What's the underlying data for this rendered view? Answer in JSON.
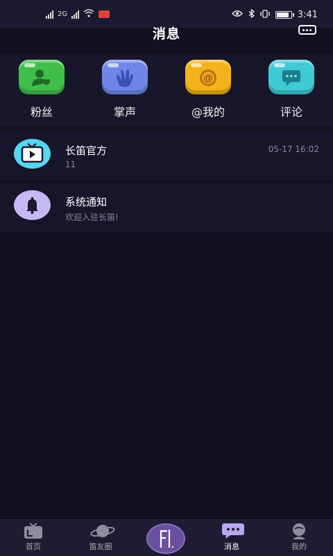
{
  "status_bar": {
    "time": "3:41",
    "network_label": "2G",
    "battery_level": 0.9
  },
  "header": {
    "title": "消息"
  },
  "categories": [
    {
      "label": "粉丝",
      "color": "#3fbf4a",
      "icon": "fans-icon"
    },
    {
      "label": "掌声",
      "color": "#6f86e8",
      "icon": "applause-icon"
    },
    {
      "label": "@我的",
      "color": "#f2b21b",
      "icon": "at-me-icon"
    },
    {
      "label": "评论",
      "color": "#3fcad6",
      "icon": "comment-icon"
    }
  ],
  "messages": [
    {
      "name": "长笛官方",
      "subtitle": "11",
      "time": "05-17 16:02",
      "avatar_color": "#55d7f1",
      "icon": "tv-icon"
    },
    {
      "name": "系统通知",
      "subtitle": "欢迎入驻长笛!",
      "time": "",
      "avatar_color": "#c5b8f3",
      "icon": "bell-icon"
    }
  ],
  "bottom_nav": {
    "items": [
      {
        "label": "首页",
        "icon": "home-tv-icon"
      },
      {
        "label": "笛友圈",
        "icon": "planet-icon"
      },
      {
        "label": "消息",
        "icon": "message-icon",
        "active": true
      },
      {
        "label": "我的",
        "icon": "profile-icon"
      }
    ],
    "center_icon": "logo-fl-icon"
  }
}
